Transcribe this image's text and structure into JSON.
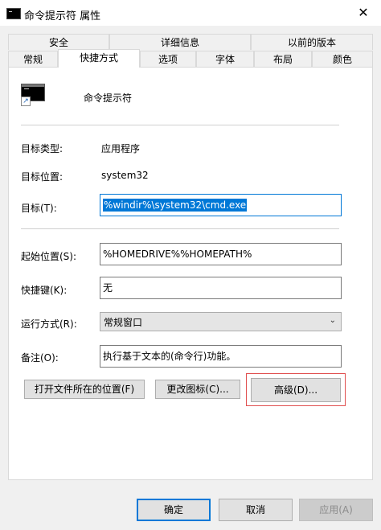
{
  "window": {
    "title": "命令提示符 属性",
    "close_glyph": "✕"
  },
  "tabs_row1": [
    "安全",
    "详细信息",
    "以前的版本"
  ],
  "tabs_row2": [
    "常规",
    "快捷方式",
    "选项",
    "字体",
    "布局",
    "颜色"
  ],
  "active_tab": "快捷方式",
  "shortcut": {
    "name": "命令提示符",
    "target_type_label": "目标类型:",
    "target_type_value": "应用程序",
    "target_location_label": "目标位置:",
    "target_location_value": "system32",
    "target_label": "目标(T):",
    "target_value": "%windir%\\system32\\cmd.exe",
    "start_in_label": "起始位置(S):",
    "start_in_value": "%HOMEDRIVE%%HOMEPATH%",
    "hotkey_label": "快捷键(K):",
    "hotkey_value": "无",
    "run_label": "运行方式(R):",
    "run_value": "常规窗口",
    "comment_label": "备注(O):",
    "comment_value": "执行基于文本的(命令行)功能。",
    "open_location_button": "打开文件所在的位置(F)",
    "change_icon_button": "更改图标(C)...",
    "advanced_button": "高级(D)..."
  },
  "footer": {
    "ok": "确定",
    "cancel": "取消",
    "apply": "应用(A)"
  },
  "colors": {
    "accent": "#0078d7",
    "highlight": "#e05050"
  },
  "icons": [
    "cmd-icon",
    "shortcut-arrow-icon",
    "chevron-down-icon",
    "close-icon"
  ]
}
